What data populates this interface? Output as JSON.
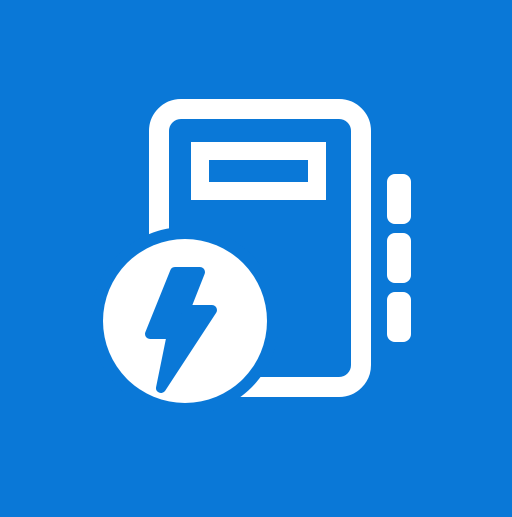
{
  "colors": {
    "background": "#0a78d7",
    "foreground": "#ffffff"
  },
  "icon": {
    "name": "notebook-lightning-icon",
    "parts": [
      "notebook-icon",
      "tabs",
      "lightning-bolt-icon"
    ]
  }
}
